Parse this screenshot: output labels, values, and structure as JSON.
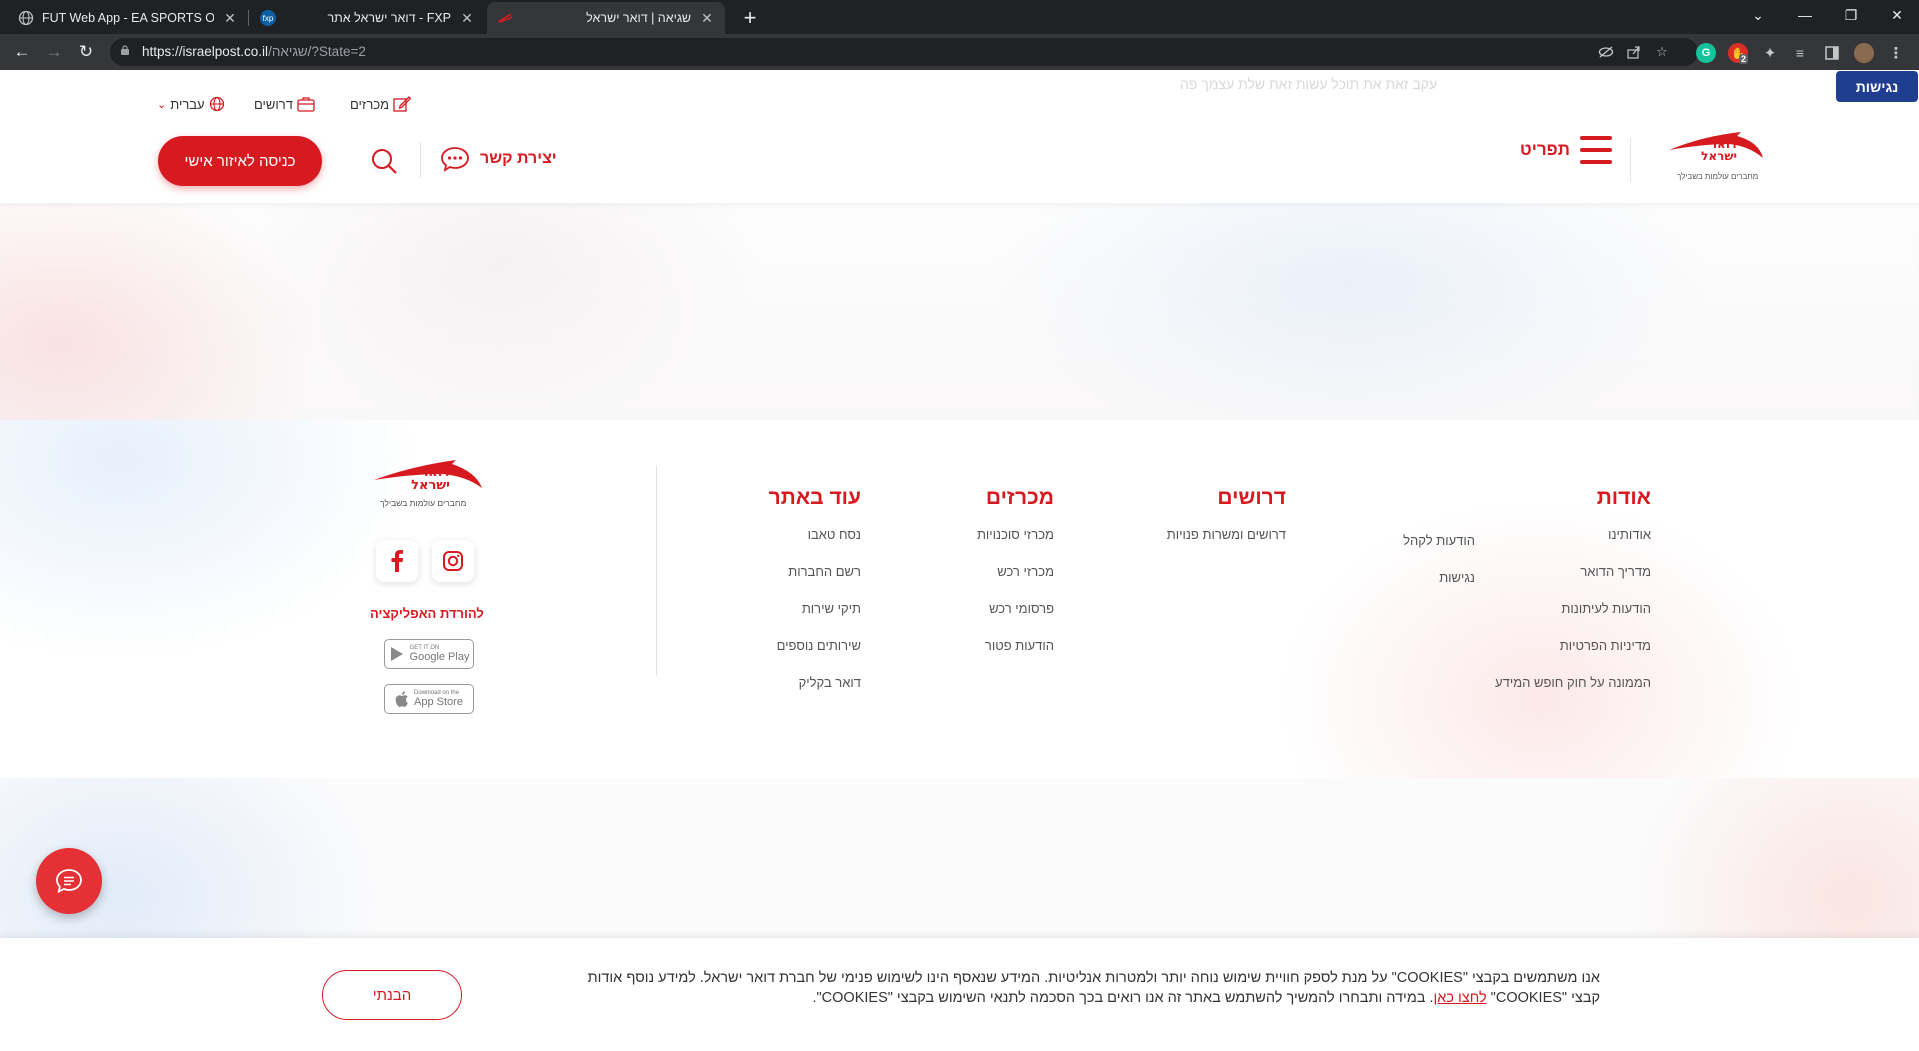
{
  "browser": {
    "tabs": [
      {
        "title": "FUT Web App - EA SPORTS Official",
        "active": false
      },
      {
        "title": "FXP - דואר ישראל אתר",
        "active": false
      },
      {
        "title": "שגיאה | דואר ישראל",
        "active": true
      }
    ],
    "new_tab": "+",
    "url_host": "https://israelpost.co.il",
    "url_path": "/שגיאה/?State=2",
    "extension_badge": "2"
  },
  "header": {
    "ghost_text": "עקב זאת את תוכל עשות זאת שלת עצמך פה",
    "accessibility_btn": "נגישות",
    "top_links": {
      "tenders": "מכרזים",
      "jobs": "דרושים",
      "language": "עברית"
    },
    "logo": {
      "line1": "דואר",
      "line2": "ישראל",
      "tagline": "מחברים עולמות בשבילך"
    },
    "menu_label": "תפריט",
    "contact_label": "יצירת קשר",
    "login_label": "כניסה לאיזור אישי"
  },
  "footer": {
    "columns": [
      {
        "title": "אודות",
        "links": [
          "אודותינו",
          "מדריך הדואר",
          "הודעות לעיתונות",
          "מדיניות הפרטיות",
          "הממונה על חוק חופש המידע"
        ]
      },
      {
        "title": "",
        "links": [
          "הודעות לקהל",
          "נגישות"
        ]
      },
      {
        "title": "דרושים",
        "links": [
          "דרושים ומשרות פנויות"
        ]
      },
      {
        "title": "מכרזים",
        "links": [
          "מכרזי סוכנויות",
          "מכרזי רכש",
          "פרסומי רכש",
          "הודעות פטור"
        ]
      },
      {
        "title": "עוד באתר",
        "links": [
          "נסח טאבו",
          "רשם החברות",
          "תיקי שירות",
          "שירותים נוספים",
          "דואר בקליק"
        ]
      }
    ],
    "app_download": "להורדת האפליקציה",
    "google_play": {
      "small": "GET IT ON",
      "big": "Google Play"
    },
    "app_store": {
      "small": "Download on the",
      "big": "App Store"
    }
  },
  "cookie": {
    "text_before": "אנו משתמשים בקבצי \"COOKIES\" על מנת לספק חוויית שימוש נוחה יותר ולמטרות אנליטיות. המידע שנאסף הינו לשימוש פנימי של חברת דואר ישראל. למידע נוסף אודות קבצי \"COOKIES\" ",
    "link": "לחצו כאן",
    "text_after": ". במידה ותבחרו להמשיך להשתמש באתר זה אנו רואים בכך הסכמה לתנאי השימוש בקבצי \"COOKIES\".",
    "ok_button": "הבנתי"
  },
  "colors": {
    "brand_red": "#d71920",
    "access_blue": "#1f3e8f",
    "chrome_dark": "#202124"
  }
}
